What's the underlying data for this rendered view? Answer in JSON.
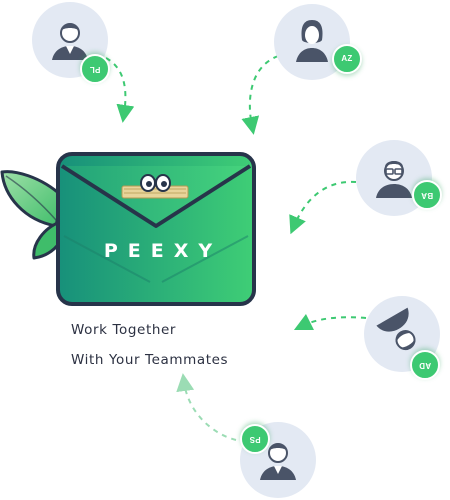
{
  "brand": {
    "name": "PEEXY",
    "logo_icon": "envelope-with-eyes-icon"
  },
  "tagline": {
    "line1": "Work Together",
    "line2": "With Your Teammates"
  },
  "colors": {
    "brand_green_dark": "#17907a",
    "brand_green_light": "#3fce76",
    "navy_outline": "#27344a",
    "avatar_bg": "#e3e9f3",
    "badge_green": "#3dc972"
  },
  "teammates": [
    {
      "initials": "PL",
      "avatar_icon": "man-avatar-icon"
    },
    {
      "initials": "AZ",
      "avatar_icon": "woman-avatar-icon"
    },
    {
      "initials": "BA",
      "avatar_icon": "man-with-glasses-avatar-icon"
    },
    {
      "initials": "AD",
      "avatar_icon": "man-with-beard-avatar-icon"
    },
    {
      "initials": "PS",
      "avatar_icon": "man-avatar-icon"
    }
  ]
}
